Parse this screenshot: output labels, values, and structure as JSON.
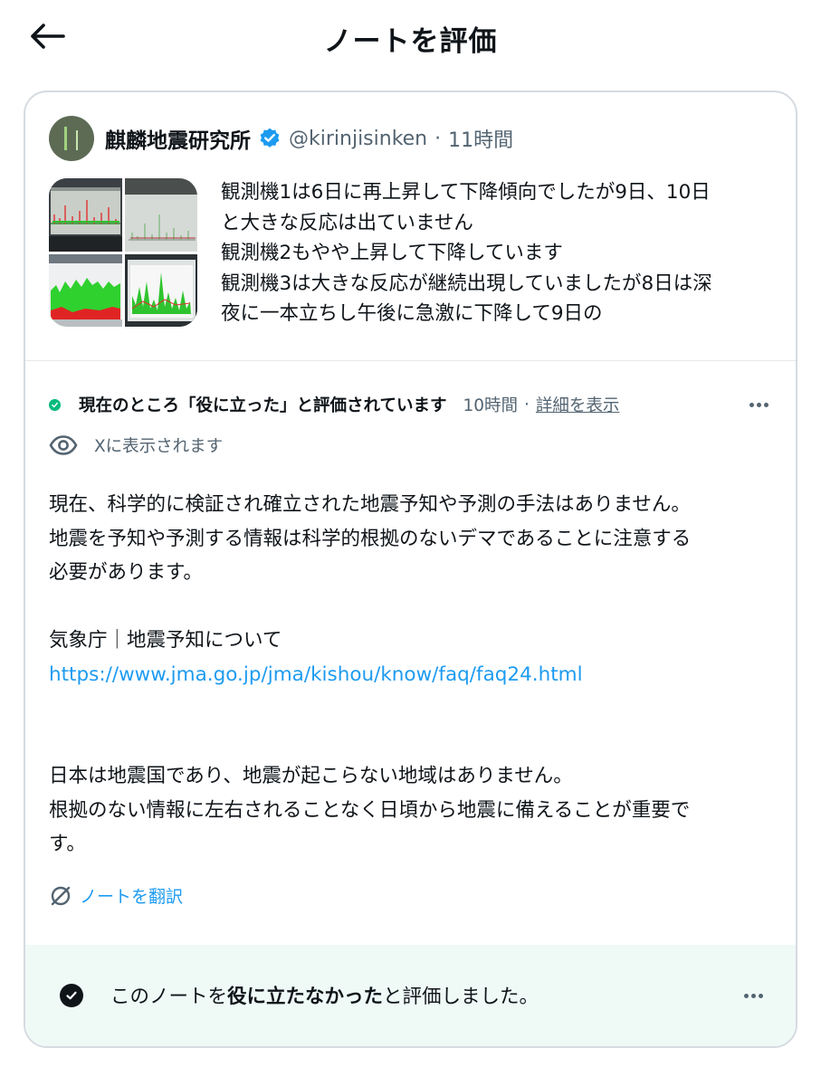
{
  "header": {
    "title": "ノートを評価",
    "back_icon": "arrow-left-icon"
  },
  "tweet": {
    "author": "麒麟地震研究所",
    "handle": "@kirinjisinken",
    "separator": "·",
    "time": "11時間",
    "verified_color": "#1d9bf0",
    "text_lines": [
      "観測機1は6日に再上昇して下降傾向でしたが9日、10日",
      "と大きな反応は出ていません",
      "観測機2もやや上昇して下降しています",
      "観測機3は大きな反応が継続出現していましたが8日は深",
      "夜に一本立ちし午後に急激に下降して9日の"
    ]
  },
  "note": {
    "status_label": "現在のところ「役に立った」と評価されています",
    "status_time": "10時間",
    "status_separator": "·",
    "details_link": "詳細を表示",
    "visibility_text": "Xに表示されます",
    "body_lines": [
      "現在、科学的に検証され確立された地震予知や予測の手法はありません。",
      "地震を予知や予測する情報は科学的根拠のないデマであることに注意する",
      "必要があります。",
      "",
      "気象庁｜地震予知について",
      "https://www.jma.go.jp/jma/kishou/know/faq/faq24.html",
      "",
      "",
      "日本は地震国であり、地震が起こらない地域はありません。",
      "根拠のない情報に左右されることなく日頃から地震に備えることが重要で",
      "す。"
    ],
    "translate_label": "ノートを翻訳",
    "status_color": "#00ba7c",
    "link_color": "#1d9bf0"
  },
  "rating": {
    "prefix": "このノートを",
    "emphasis": "役に立たなかった",
    "suffix": "と評価しました。",
    "bar_color": "#effaf7"
  }
}
